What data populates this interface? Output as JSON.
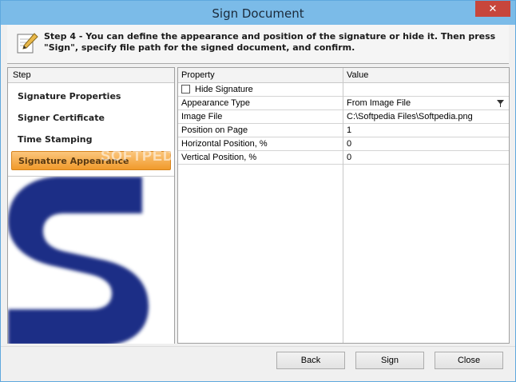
{
  "window": {
    "title": "Sign Document",
    "close_glyph": "✕"
  },
  "header": {
    "text": "Step 4 - You can define the appearance and position of the signature or hide it. Then press \"Sign\", specify file path for the signed document, and confirm.",
    "icon": "pen-paper-icon"
  },
  "steps": {
    "header": "Step",
    "items": [
      {
        "label": "Signature Properties"
      },
      {
        "label": "Signer Certificate"
      },
      {
        "label": "Time Stamping"
      },
      {
        "label": "Signature Appearance"
      }
    ],
    "watermark": "SOFTPEDIA"
  },
  "grid": {
    "col_property": "Property",
    "col_value": "Value",
    "hide_signature_label": "Hide Signature",
    "rows": [
      {
        "name": "Appearance Type",
        "value": "From Image File"
      },
      {
        "name": "Image File",
        "value": "C:\\Softpedia Files\\Softpedia.png"
      },
      {
        "name": "Position on Page",
        "value": "1"
      },
      {
        "name": "Horizontal Position, %",
        "value": "0"
      },
      {
        "name": "Vertical Position, %",
        "value": "0"
      }
    ]
  },
  "buttons": {
    "back": "Back",
    "sign": "Sign",
    "close": "Close"
  },
  "colors": {
    "accent": "#7bbbe8",
    "selected_step": "#f19a2b",
    "preview_logo": "#1d2e86"
  }
}
